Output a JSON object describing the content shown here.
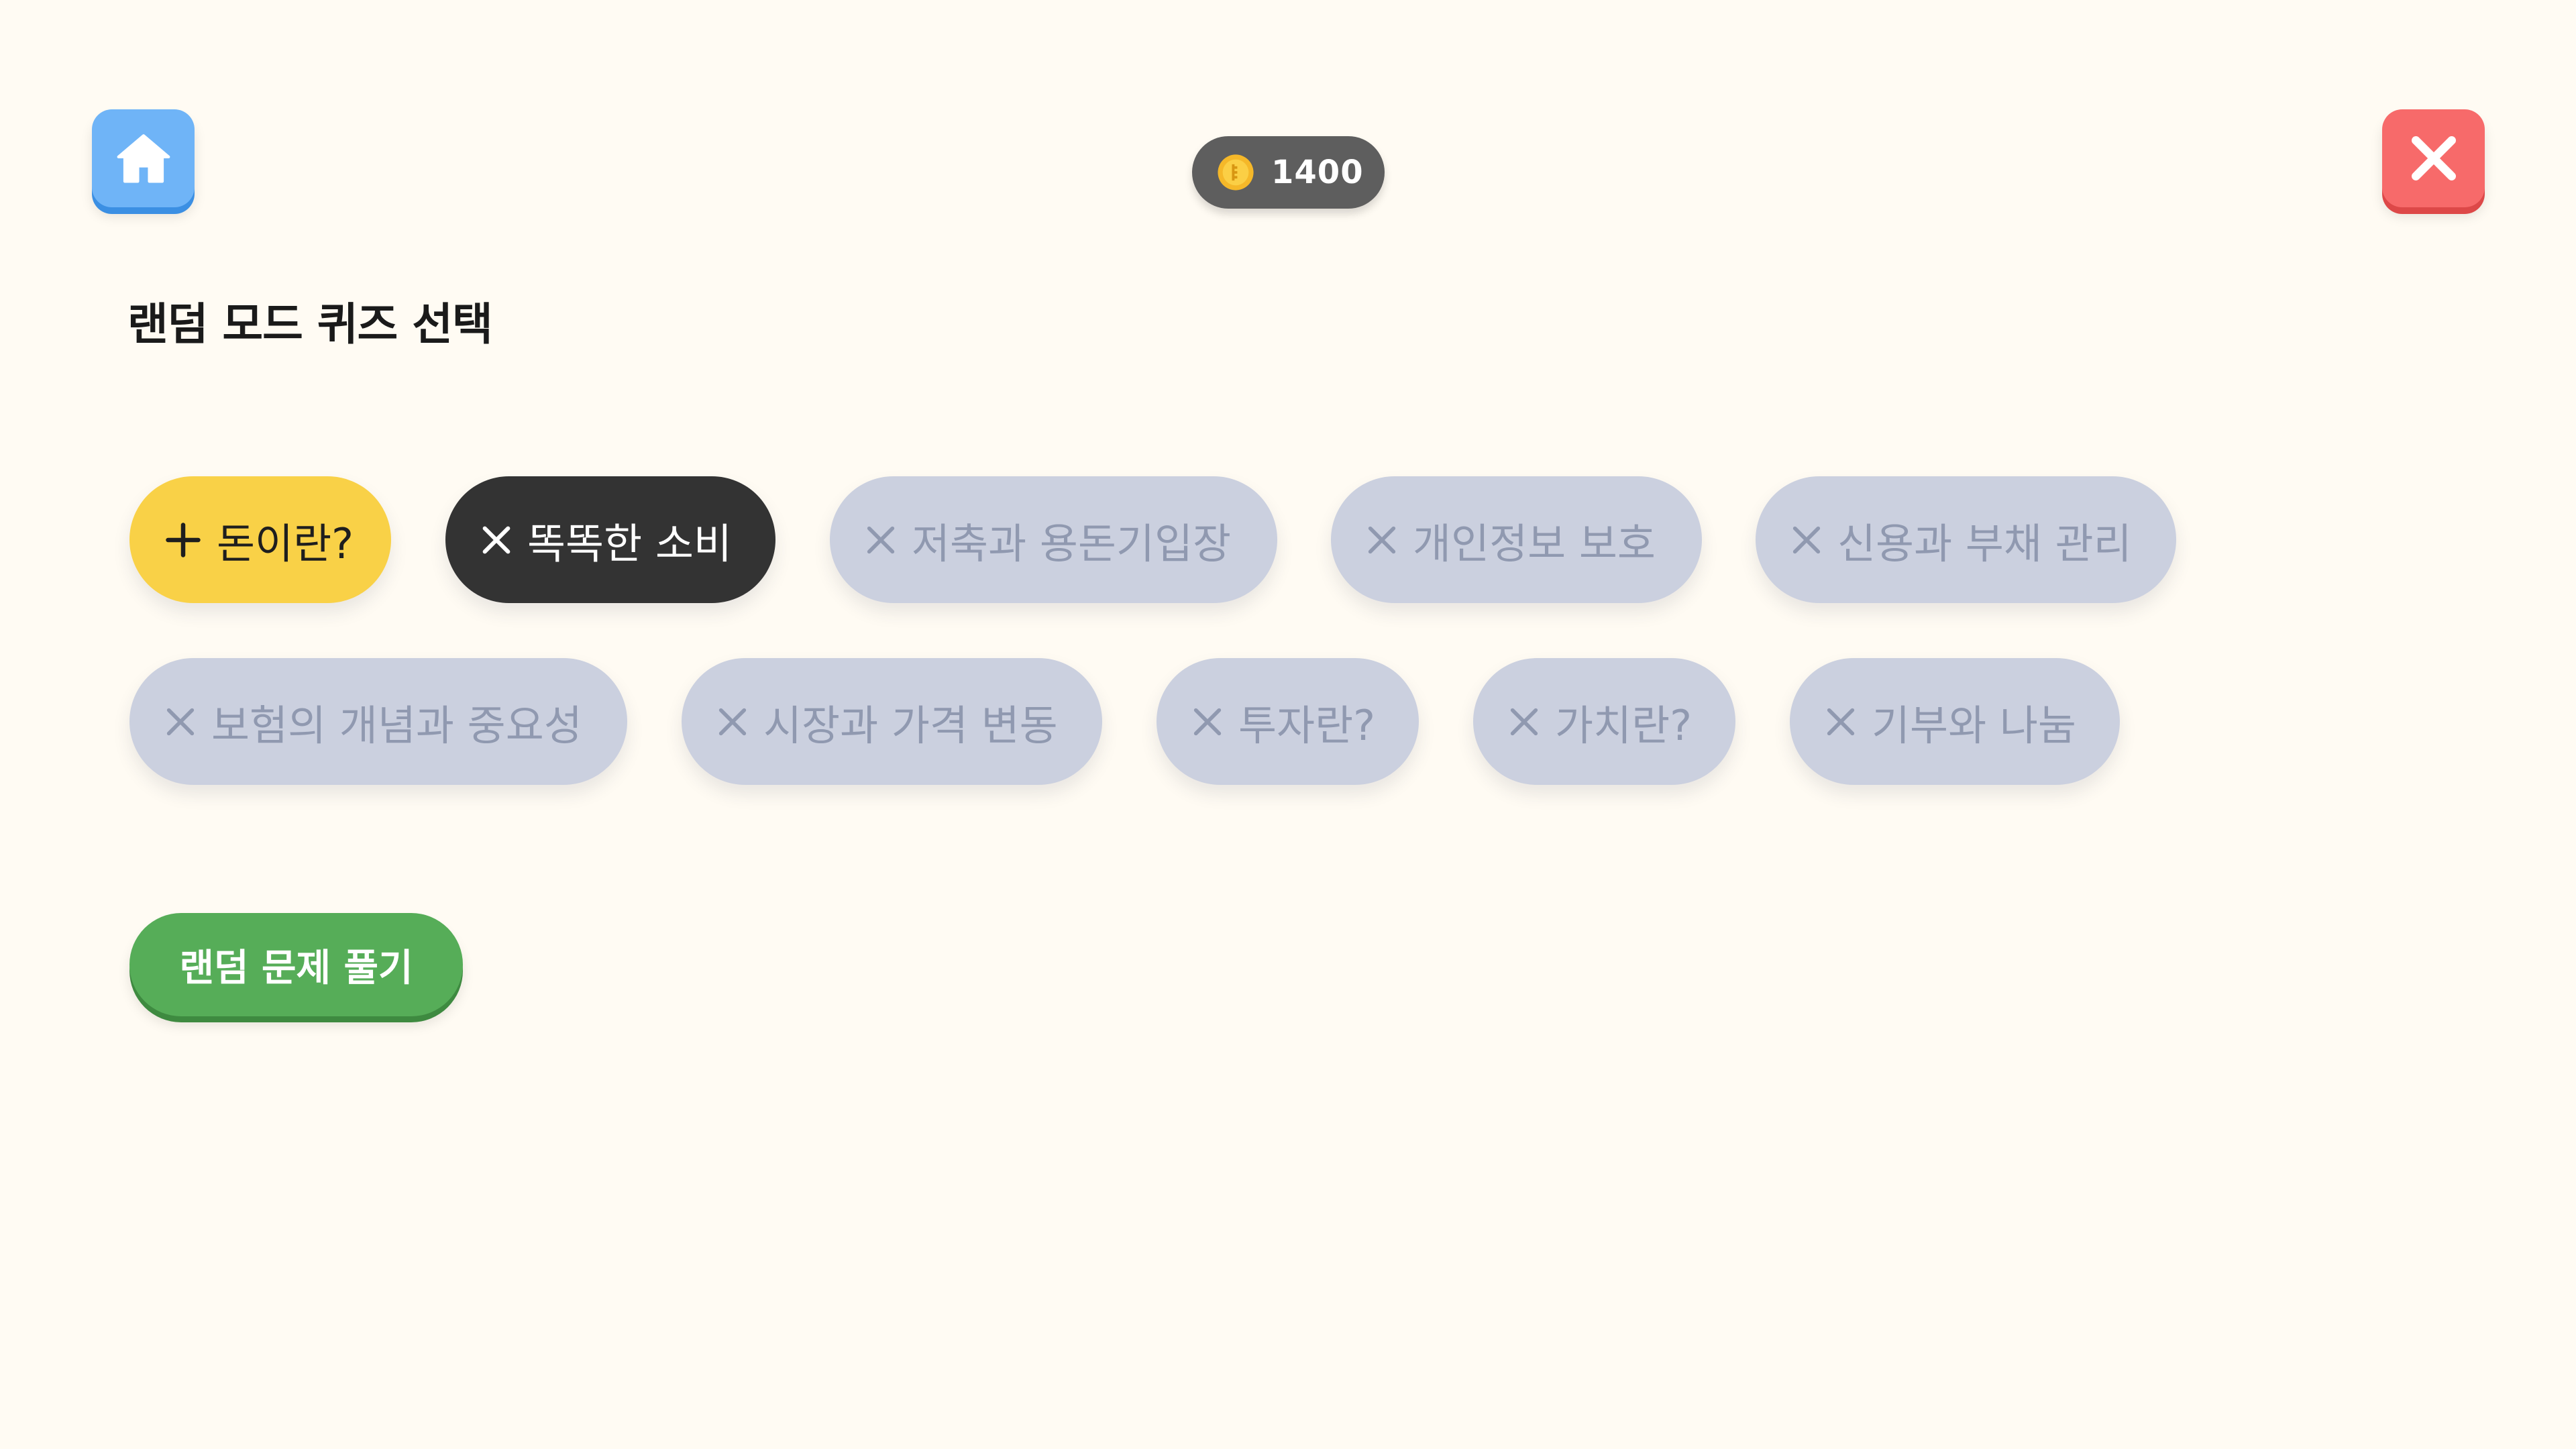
{
  "header": {
    "home_icon": "home-icon",
    "close_icon": "close-icon",
    "coin_icon": "coin-icon",
    "coins": "1400"
  },
  "title": "랜덤 모드 퀴즈 선택",
  "topics": [
    {
      "label": "돈이란?",
      "state": "add",
      "icon": "plus-icon"
    },
    {
      "label": "똑똑한 소비",
      "state": "selected",
      "icon": "x-icon"
    },
    {
      "label": "저축과 용돈기입장",
      "state": "disabled",
      "icon": "x-icon"
    },
    {
      "label": "개인정보 보호",
      "state": "disabled",
      "icon": "x-icon"
    },
    {
      "label": "신용과 부채 관리",
      "state": "disabled",
      "icon": "x-icon"
    },
    {
      "label": "보험의 개념과 중요성",
      "state": "disabled",
      "icon": "x-icon"
    },
    {
      "label": "시장과 가격 변동",
      "state": "disabled",
      "icon": "x-icon"
    },
    {
      "label": "투자란?",
      "state": "disabled",
      "icon": "x-icon"
    },
    {
      "label": "가치란?",
      "state": "disabled",
      "icon": "x-icon"
    },
    {
      "label": "기부와 나눔",
      "state": "disabled",
      "icon": "x-icon"
    }
  ],
  "play_button": "랜덤 문제 풀기",
  "colors": {
    "background": "#fffbf3",
    "home": "#6fb4f7",
    "close": "#f76a6a",
    "chip_add": "#f9d147",
    "chip_selected": "#333333",
    "chip_disabled": "#cbd0df",
    "play": "#56ad58"
  }
}
